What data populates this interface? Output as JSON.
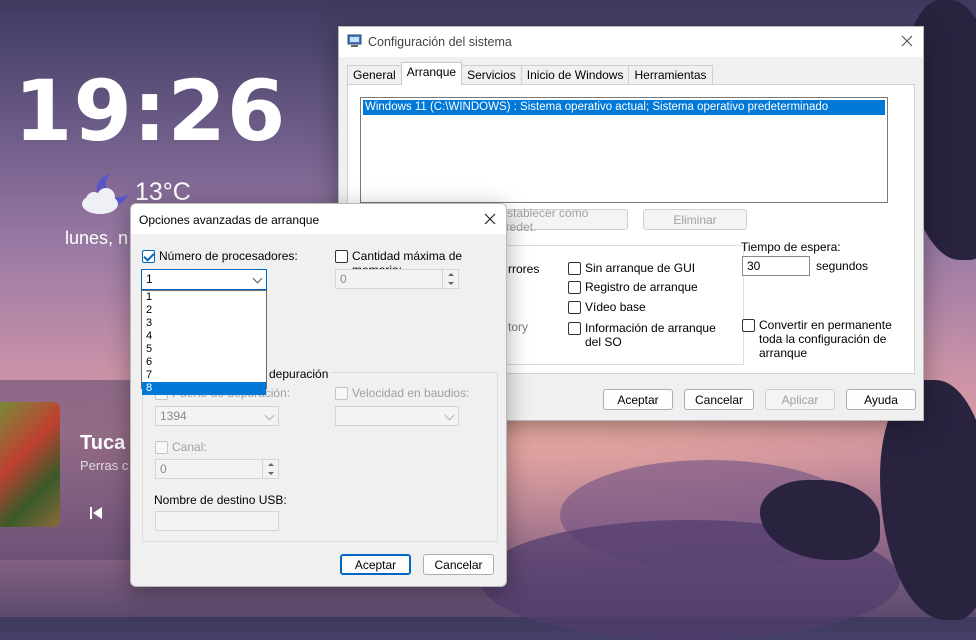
{
  "lockscreen": {
    "time": "19:26",
    "temperature": "13°C",
    "date": "lunes, n",
    "media": {
      "title": "Tuca",
      "artist": "Perras c"
    }
  },
  "syscfg": {
    "title": "Configuración del sistema",
    "tabs": [
      "General",
      "Arranque",
      "Servicios",
      "Inicio de Windows",
      "Herramientas"
    ],
    "os_entry": "Windows 11 (C:\\WINDOWS) : Sistema operativo actual; Sistema operativo predeterminado",
    "set_default_label": "Establecer como predet.",
    "delete_label": "Eliminar",
    "boot_options_partial": {
      "errores": "rrores",
      "history": "tory"
    },
    "boot_checks": {
      "no_gui": "Sin arranque de GUI",
      "boot_log": "Registro de arranque",
      "base_video": "Vídeo base",
      "os_boot_info": "Información de arranque del SO"
    },
    "timeout_label": "Tiempo de espera:",
    "timeout_value": "30",
    "timeout_unit": "segundos",
    "make_permanent": "Convertir en permanente toda la configuración de arranque",
    "buttons": {
      "ok": "Aceptar",
      "cancel": "Cancelar",
      "apply": "Aplicar",
      "help": "Ayuda"
    }
  },
  "advanced": {
    "title": "Opciones avanzadas de arranque",
    "num_processors_label": "Número de procesadores:",
    "num_processors_value": "1",
    "processor_options": [
      "1",
      "2",
      "3",
      "4",
      "5",
      "6",
      "7",
      "8"
    ],
    "processor_highlighted": "8",
    "max_memory_label": "Cantidad máxima de memoria:",
    "max_memory_value": "0",
    "debug_group_label": "depuración",
    "debug_port_label": "Puerto de depuración:",
    "debug_port_value": "1394",
    "baud_rate_label": "Velocidad en baudios:",
    "channel_label": "Canal:",
    "channel_value": "0",
    "usb_target_label": "Nombre de destino USB:",
    "buttons": {
      "ok": "Aceptar",
      "cancel": "Cancelar"
    }
  }
}
